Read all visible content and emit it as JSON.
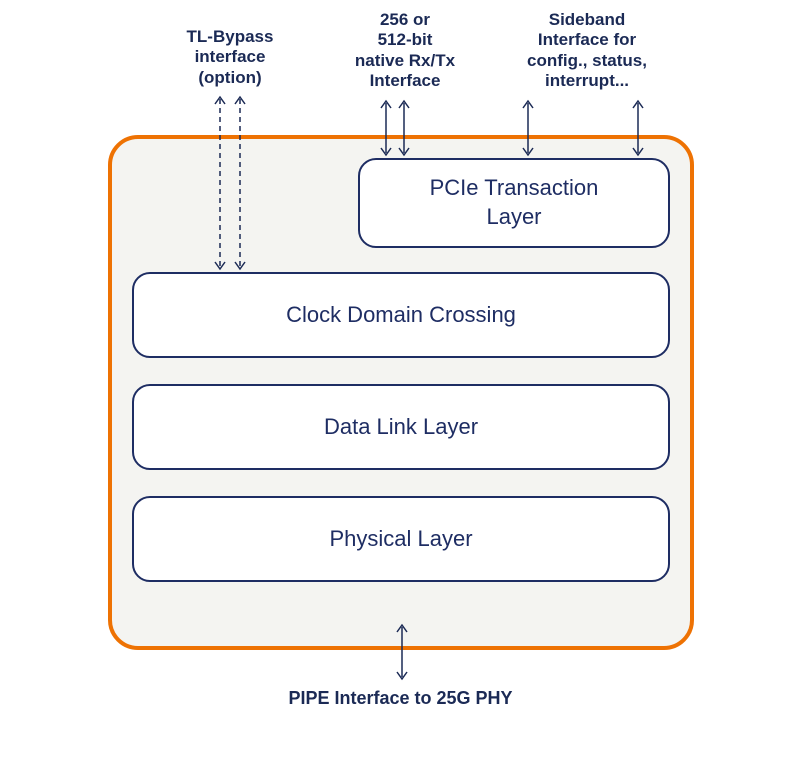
{
  "labels": {
    "top_left": "TL-Bypass\ninterface\n(option)",
    "top_mid": "256 or\n512-bit\nnative Rx/Tx\nInterface",
    "top_right": "Sideband\nInterface for\nconfig., status,\ninterrupt...",
    "bottom": "PIPE Interface to 25G PHY"
  },
  "layers": {
    "transaction": "PCIe Transaction\nLayer",
    "cdc": "Clock Domain Crossing",
    "dll": "Data Link Layer",
    "phy": "Physical Layer"
  }
}
